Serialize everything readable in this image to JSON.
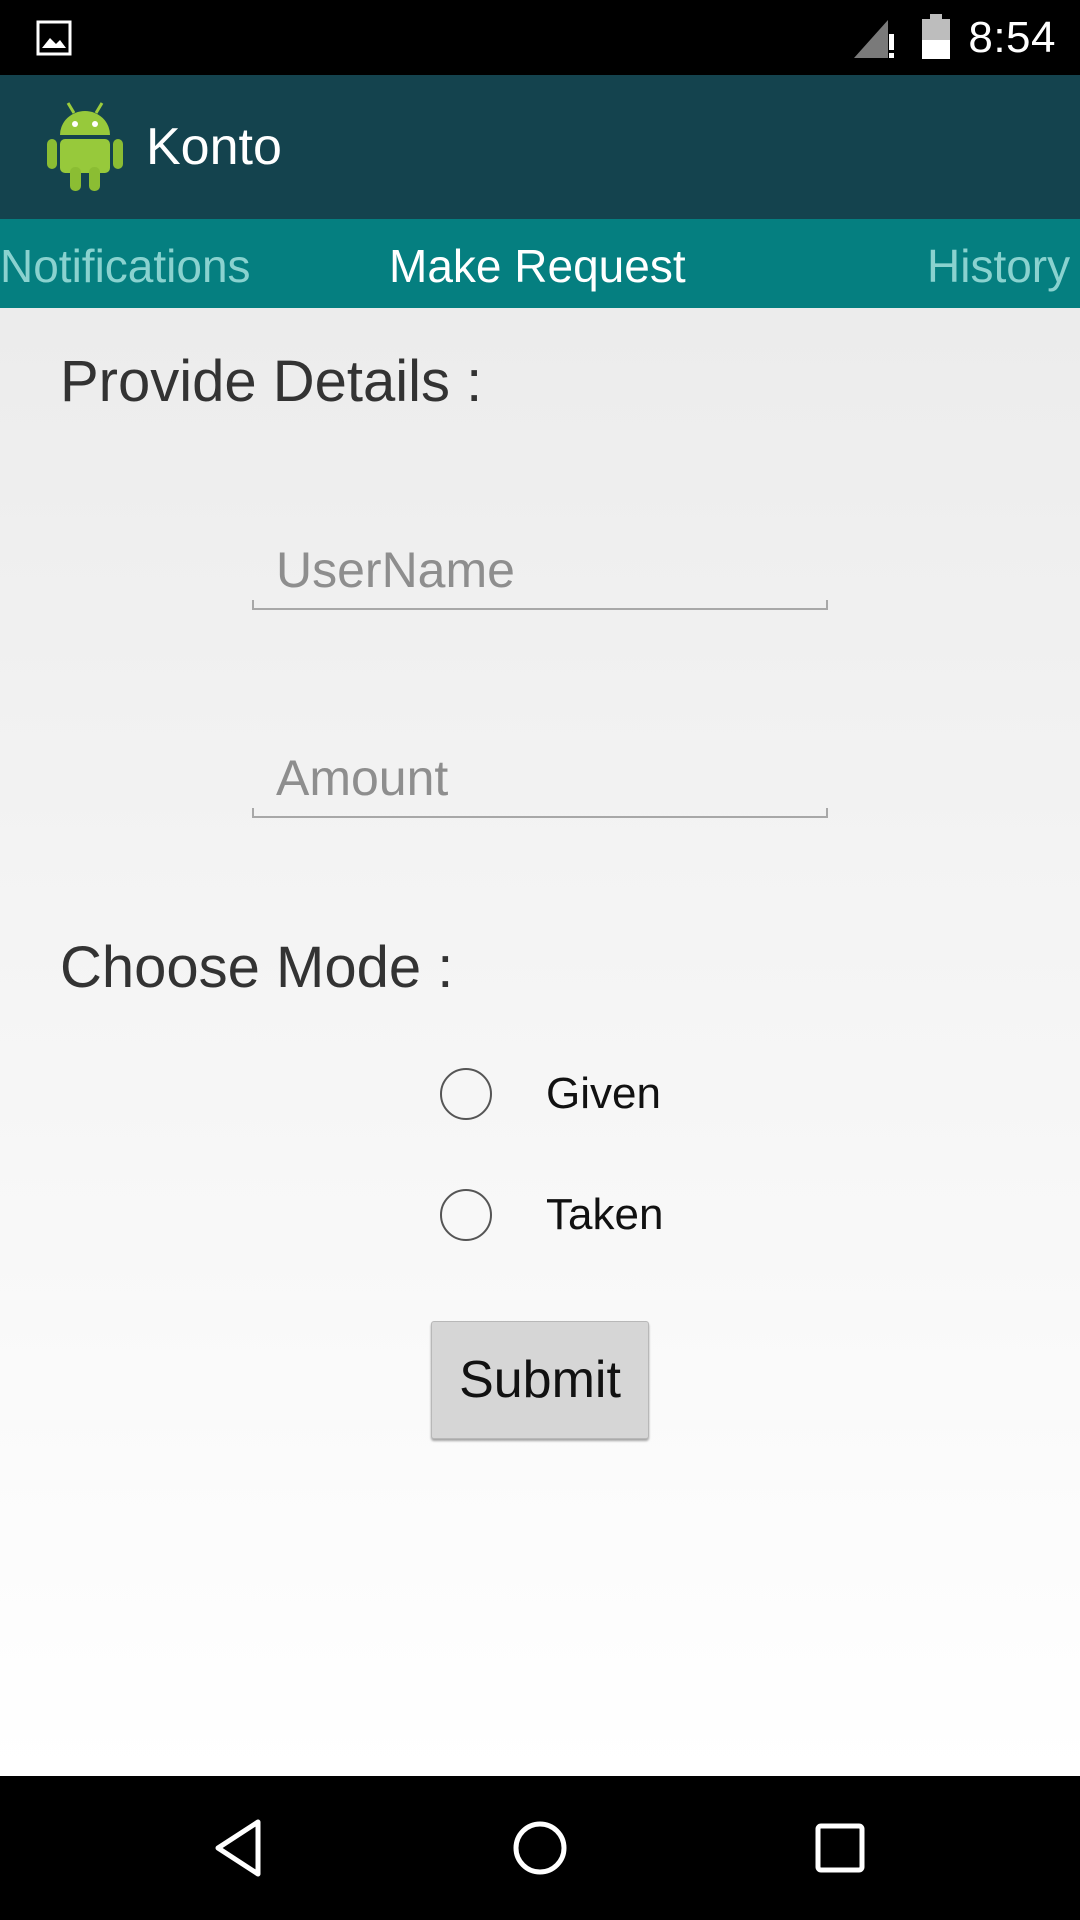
{
  "status_bar": {
    "time": "8:54",
    "icons": [
      "gallery-icon",
      "signal-icon",
      "battery-icon"
    ]
  },
  "action_bar": {
    "title": "Konto",
    "icon": "android-icon"
  },
  "tabs": [
    {
      "label": "Notifications",
      "active": false
    },
    {
      "label": "Make Request",
      "active": true
    },
    {
      "label": "History",
      "active": false
    }
  ],
  "form": {
    "details_heading": "Provide Details :",
    "username": {
      "placeholder": "UserName",
      "value": ""
    },
    "amount": {
      "placeholder": "Amount",
      "value": ""
    },
    "mode_heading": "Choose Mode :",
    "modes": [
      {
        "label": "Given",
        "checked": false
      },
      {
        "label": "Taken",
        "checked": false
      }
    ],
    "submit_label": "Submit"
  },
  "nav_bar": {
    "icons": [
      "back-icon",
      "home-icon",
      "recents-icon"
    ]
  },
  "colors": {
    "action_bar": "#14434e",
    "tab_strip": "#057f80",
    "tab_active_text": "#ffffff",
    "tab_inactive_text": "#8ad2cf"
  }
}
